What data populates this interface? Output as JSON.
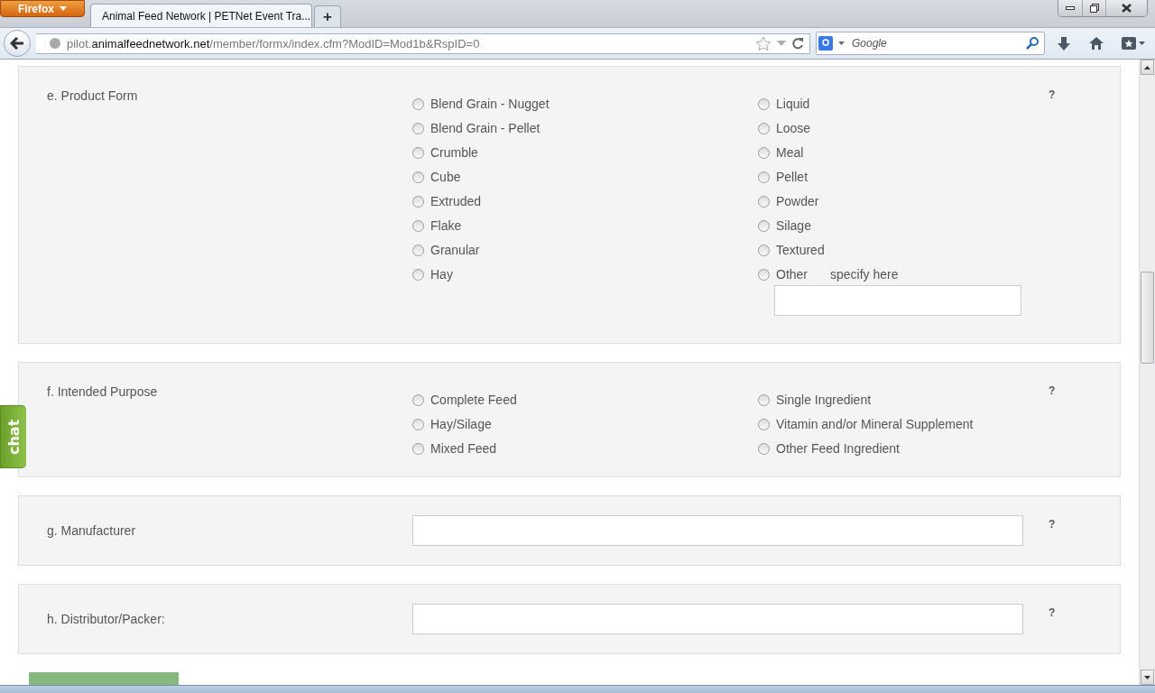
{
  "browser": {
    "menu_button": "Firefox",
    "tab_title": "Animal Feed Network | PETNet Event Tra...",
    "new_tab": "+",
    "url_prefix": "pilot.",
    "url_host": "animalfeednetwork.net",
    "url_path": "/member/formx/index.cfm?ModID=Mod1b&RspID=0",
    "search_placeholder": "Google"
  },
  "chat_tab": "chat",
  "sections": [
    {
      "kind": "radio",
      "label": "e. Product Form",
      "help": "?",
      "columns": [
        [
          {
            "label": "Blend Grain - Nugget",
            "selected": false
          },
          {
            "label": "Blend Grain - Pellet",
            "selected": false
          },
          {
            "label": "Crumble",
            "selected": false
          },
          {
            "label": "Cube",
            "selected": false
          },
          {
            "label": "Extruded",
            "selected": false
          },
          {
            "label": "Flake",
            "selected": false
          },
          {
            "label": "Granular",
            "selected": false
          },
          {
            "label": "Hay",
            "selected": false
          }
        ],
        [
          {
            "label": "Liquid",
            "selected": false
          },
          {
            "label": "Loose",
            "selected": false
          },
          {
            "label": "Meal",
            "selected": false
          },
          {
            "label": "Pellet",
            "selected": false
          },
          {
            "label": "Powder",
            "selected": false
          },
          {
            "label": "Silage",
            "selected": false
          },
          {
            "label": "Textured",
            "selected": false
          },
          {
            "label": "Other",
            "selected": false,
            "specify": "specify here"
          }
        ]
      ]
    },
    {
      "kind": "radio",
      "label": "f. Intended Purpose",
      "help": "?",
      "columns": [
        [
          {
            "label": "Complete Feed",
            "selected": false
          },
          {
            "label": "Hay/Silage",
            "selected": false
          },
          {
            "label": "Mixed Feed",
            "selected": false
          }
        ],
        [
          {
            "label": "Single Ingredient",
            "selected": false
          },
          {
            "label": "Vitamin and/or Mineral Supplement",
            "selected": false
          },
          {
            "label": "Other Feed Ingredient",
            "selected": false
          }
        ]
      ]
    },
    {
      "kind": "text",
      "label": "g. Manufacturer",
      "help": "?"
    },
    {
      "kind": "text",
      "label": "h. Distributor/Packer:",
      "help": "?"
    }
  ]
}
